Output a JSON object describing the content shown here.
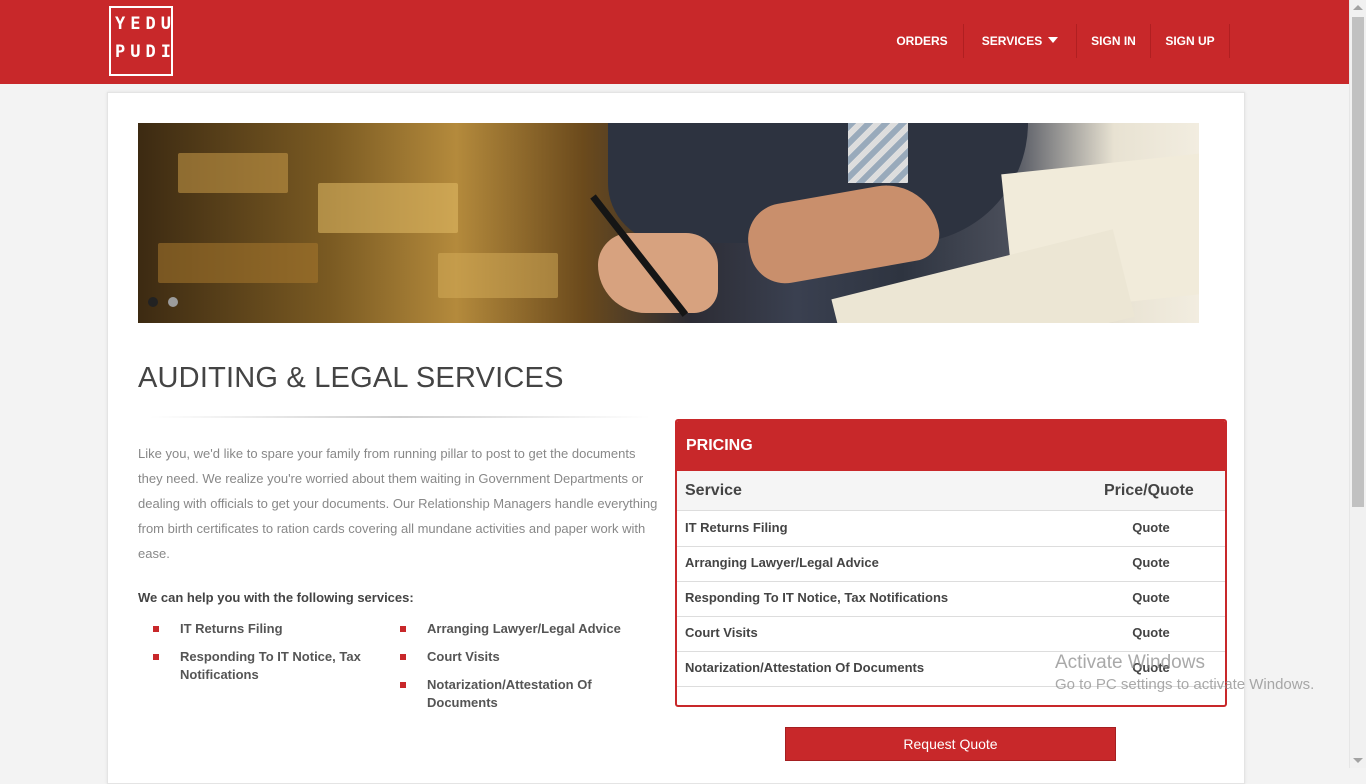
{
  "header": {
    "logo": {
      "line1": "YEDU",
      "line2": "PUDI"
    },
    "nav": [
      {
        "label": "ORDERS"
      },
      {
        "label": "SERVICES"
      },
      {
        "label": "SIGN IN"
      },
      {
        "label": "SIGN UP"
      }
    ]
  },
  "main": {
    "title": "AUDITING & LEGAL SERVICES",
    "intro": "Like you, we'd like to spare your family from running pillar to post to get the documents they need. We realize you're worried about them waiting in Government Departments or dealing with officials to get your documents. Our Relationship Managers handle everything from birth certificates to ration cards covering all mundane activities and paper work with ease.",
    "help_heading": "We can help you with the following services:",
    "services_left": [
      "IT Returns Filing",
      "Responding To IT Notice, Tax Notifications"
    ],
    "services_right": [
      "Arranging Lawyer/Legal Advice",
      "Court Visits",
      "Notarization/Attestation Of Documents"
    ]
  },
  "pricing": {
    "title": "PRICING",
    "col_service": "Service",
    "col_price": "Price/Quote",
    "rows": [
      {
        "service": "IT Returns Filing",
        "price": "Quote"
      },
      {
        "service": "Arranging Lawyer/Legal Advice",
        "price": "Quote"
      },
      {
        "service": "Responding To IT Notice, Tax Notifications",
        "price": "Quote"
      },
      {
        "service": "Court Visits",
        "price": "Quote"
      },
      {
        "service": "Notarization/Attestation Of Documents",
        "price": "Quote"
      }
    ],
    "button_label": "Request Quote"
  },
  "slider": {
    "active_slide": 1,
    "slide_count": 2
  },
  "watermark": {
    "line1": "Activate Windows",
    "line2": "Go to PC settings to activate Windows."
  },
  "colors": {
    "brand_red": "#c8282a",
    "background": "#f3f3f3"
  },
  "icons": {
    "dropdown": "caret-down-icon",
    "bullet": "square-bullet-icon"
  }
}
